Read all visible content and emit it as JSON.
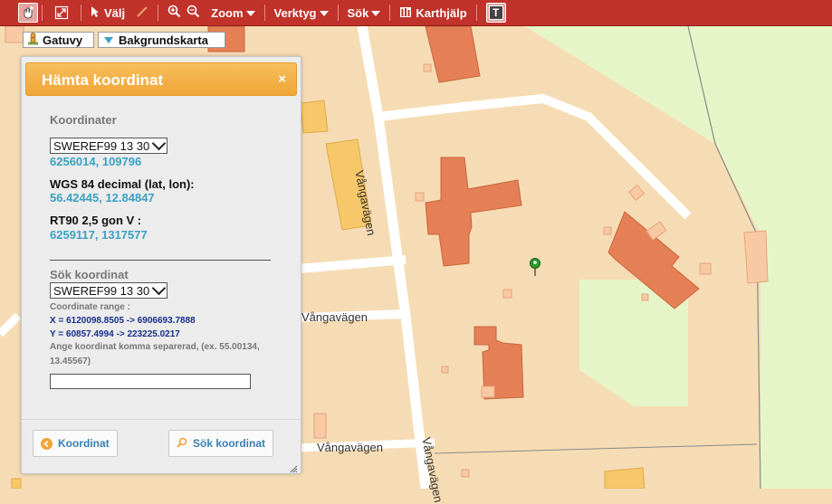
{
  "toolbar": {
    "select_label": "Välj",
    "zoom_label": "Zoom",
    "tools_label": "Verktyg",
    "search_label": "Sök",
    "maphelp_label": "Karthjälp",
    "text_tool_glyph": "T"
  },
  "layers": {
    "street_label": "Gatuvy",
    "background_label": "Bakgrundskarta"
  },
  "map": {
    "street_labels": [
      "Vångavägen",
      "Vångavägen",
      "Vångavägen",
      "Vångavägen"
    ]
  },
  "panel": {
    "title": "Hämta koordinat",
    "close": "×",
    "coordinates_heading": "Koordinater",
    "projection_selected": "SWEREF99 13 30",
    "sweref_value": "6256014, 109796",
    "wgs_heading": "WGS 84 decimal (lat, lon):",
    "wgs_value": "56.42445, 12.84847",
    "rt90_heading": "RT90 2,5 gon V :",
    "rt90_value": "6259117, 1317577",
    "search_heading": "Sök koordinat",
    "search_projection_selected": "SWEREF99 13 30",
    "range_label": "Coordinate range :",
    "range_x": "X = 6120098.8505 -> 6906693.7888",
    "range_y": "Y = 60857.4994 -> 223225.0217",
    "hint": "Ange koordinat komma separerad, (ex. 55.00134, 13.45567)",
    "input_value": "",
    "coord_button": "Koordinat",
    "search_button": "Sök koordinat"
  },
  "colors": {
    "toolbar": "#c0322a",
    "panel_header": "#f0a537",
    "coord_value": "#3aa1c2",
    "map_base": "#f6dcb4",
    "building": "#e57f55",
    "grass": "#e6f5c8"
  }
}
